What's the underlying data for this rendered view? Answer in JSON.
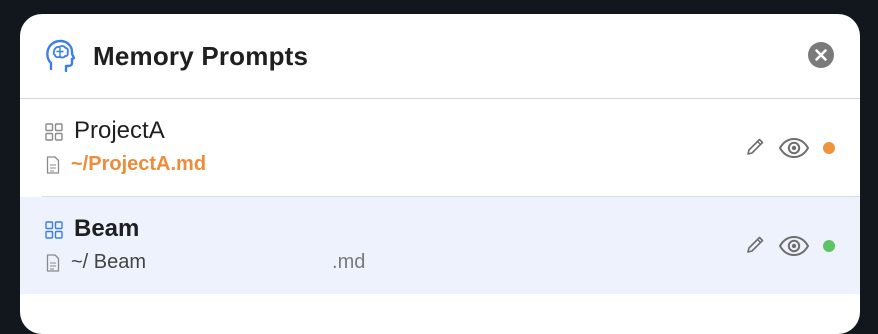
{
  "header": {
    "title": "Memory Prompts",
    "icon": "brain-head-icon",
    "close_icon": "close-icon",
    "accent_color": "#3b7ee8"
  },
  "prompts": [
    {
      "name": "ProjectA",
      "path_prefix": "~/ProjectA.md",
      "path_suffix": "",
      "status_color": "#f0933f",
      "selected": false
    },
    {
      "name": "Beam",
      "path_prefix": "~/ Beam",
      "path_suffix": ".md",
      "status_color": "#5cc465",
      "selected": true
    }
  ],
  "icons": {
    "grid": "grid-icon",
    "file": "file-icon",
    "edit": "pencil-icon",
    "preview": "eye-icon",
    "status": "status-dot"
  }
}
